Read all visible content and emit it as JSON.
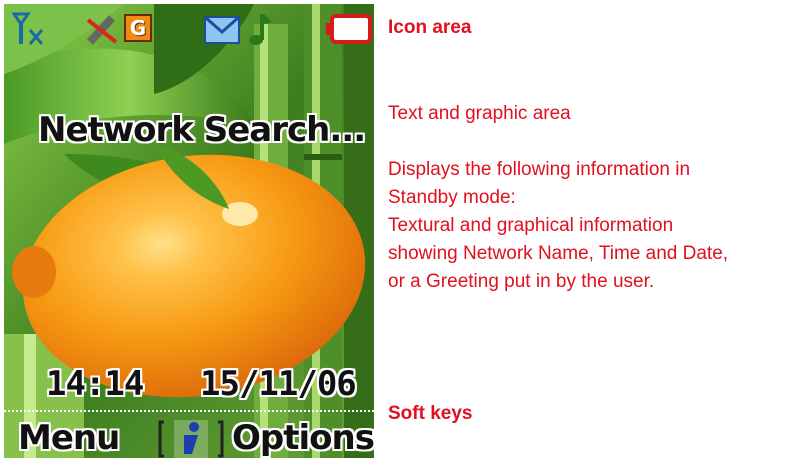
{
  "screen": {
    "status_icons": [
      "signal-icon",
      "no-network-icon",
      "gprs-icon",
      "message-icon",
      "music-icon",
      "battery-icon"
    ],
    "gprs_letter": "G",
    "network_text": "Network Search...",
    "time": "14:14",
    "date": "15/11/06",
    "softkeys": {
      "left": "Menu",
      "right": "Options"
    }
  },
  "annotations": {
    "icon_area": "Icon area",
    "text_area": "Text and graphic area",
    "description": [
      "Displays the following information in",
      "Standby mode:",
      "Textural and graphical information",
      "showing Network Name, Time and Date,",
      "or a Greeting put in by the user."
    ],
    "soft_keys": "Soft keys"
  },
  "colors": {
    "annotation": "#e0101e",
    "lemon": "#f39a12",
    "leaf": "#3f8f22"
  }
}
